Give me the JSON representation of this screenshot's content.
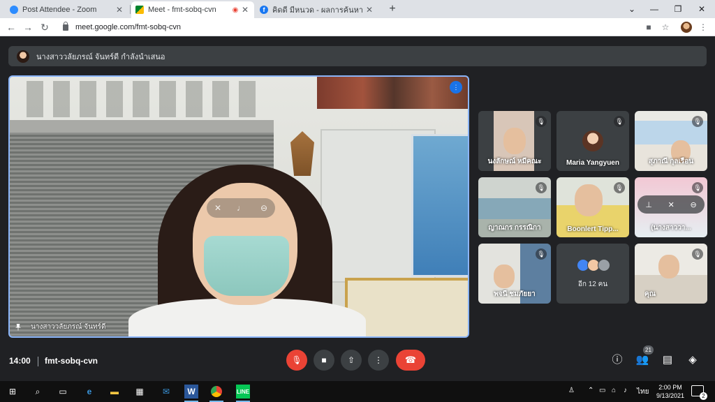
{
  "browser": {
    "tabs": [
      {
        "title": "Post Attendee - Zoom",
        "favicon": "zoom-icon",
        "color": "#2d8cff"
      },
      {
        "title": "Meet - fmt-sobq-cvn",
        "favicon": "meet-icon",
        "color": "#00832d"
      },
      {
        "title": "คิดดี มีหนวด - ผลการค้นหา | Facebook",
        "favicon": "facebook-icon",
        "color": "#1877f2"
      }
    ],
    "url": "meet.google.com/fmt-sobq-cvn"
  },
  "meet": {
    "presenting_text": "นางสาววลัยภรณ์ จันทร์ดี กำลังนำเสนอ",
    "main_speaker_name": "นางสาววลัยภรณ์ จันทร์ดี",
    "tiles": [
      {
        "name": "นงลักษณ์ หมีคณะ",
        "muted": true
      },
      {
        "name": "Maria Yangyuen",
        "muted": true
      },
      {
        "name": "สุภาณี กุลเรือน",
        "muted": true
      },
      {
        "name": "ญาณกร กรรณิกา",
        "muted": true
      },
      {
        "name": "Boonlert Tipp...",
        "muted": true
      },
      {
        "name": "(นางสาววา...",
        "muted": true
      },
      {
        "name": "พจนี ชมภัยยา",
        "muted": true
      },
      {
        "name": "อีก 12 คน",
        "muted": false
      },
      {
        "name": "คุณ",
        "muted": true
      }
    ],
    "time": "14:00",
    "meeting_code": "fmt-sobq-cvn",
    "participant_count": "21"
  },
  "taskbar": {
    "language": "ไทย",
    "time": "2:00 PM",
    "date": "9/13/2021",
    "notification_count": "2"
  },
  "colors": {
    "meet_bg": "#202124",
    "tile_bg": "#3c4043",
    "active_border": "#8ab4f8",
    "danger": "#ea4335"
  }
}
